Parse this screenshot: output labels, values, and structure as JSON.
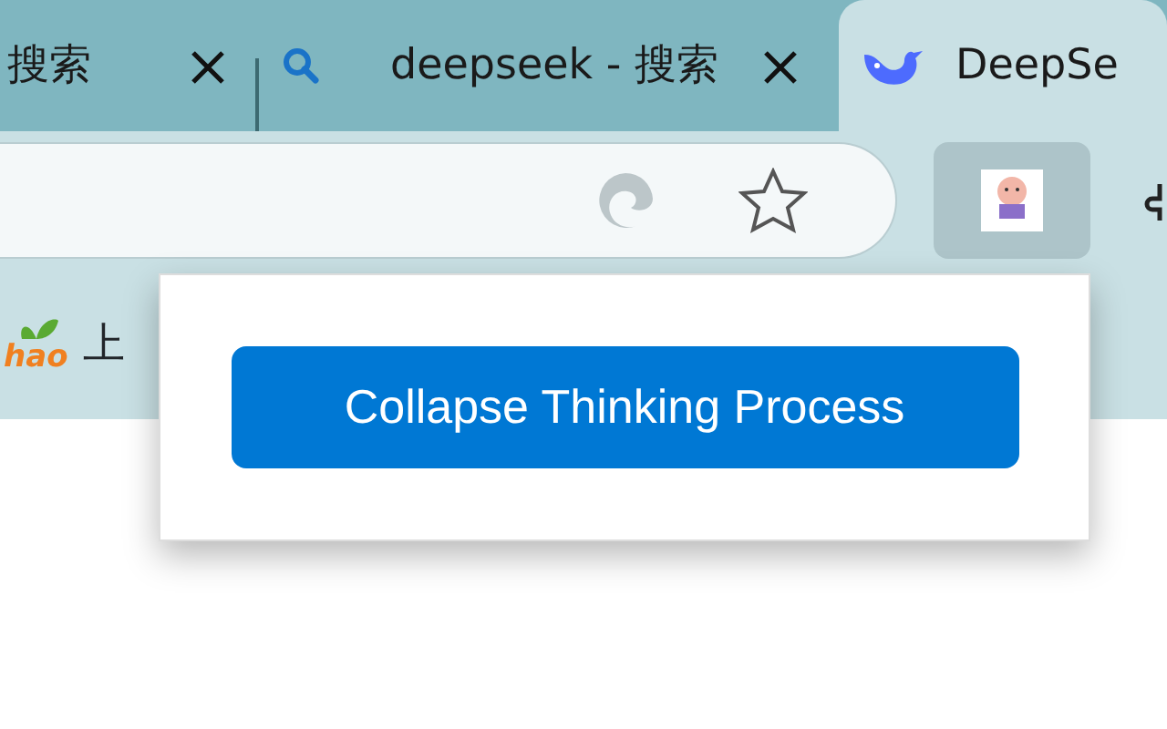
{
  "tabs": [
    {
      "title": "搜索",
      "selected": false,
      "kind": "plain"
    },
    {
      "title": "deepseek - 搜索",
      "selected": false,
      "kind": "search"
    },
    {
      "title": "DeepSe",
      "selected": true,
      "kind": "whale"
    }
  ],
  "toolbar": {
    "extension_active": true
  },
  "bookmarks": [
    {
      "icon_text": "hao",
      "label": "上"
    }
  ],
  "popup": {
    "button": "Collapse Thinking Process"
  }
}
